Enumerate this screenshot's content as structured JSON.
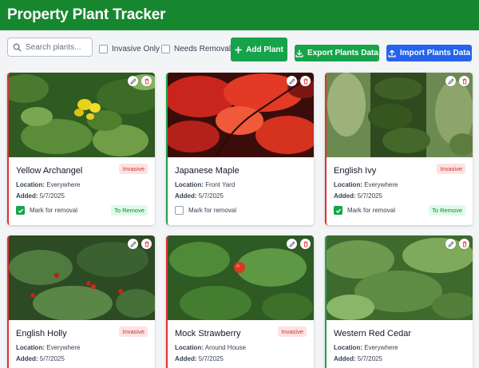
{
  "app": {
    "title": "Property Plant Tracker"
  },
  "toolbar": {
    "search_placeholder": "Search plants...",
    "filter_invasive_label": "Invasive Only",
    "filter_removal_label": "Needs Removal",
    "add_label": "Add Plant",
    "export_label": "Export Plants Data",
    "import_label": "Import Plants Data"
  },
  "labels": {
    "location": "Location:",
    "added": "Added:",
    "mark_removal": "Mark for removal",
    "invasive_badge": "Invasive",
    "remove_badge": "To Remove"
  },
  "plants": [
    {
      "name": "Yellow Archangel",
      "location": "Everywhere",
      "added": "5/7/2025",
      "invasive": true,
      "marked": true
    },
    {
      "name": "Japanese Maple",
      "location": "Front Yard",
      "added": "5/7/2025",
      "invasive": false,
      "marked": false
    },
    {
      "name": "English Ivy",
      "location": "Everywhere",
      "added": "5/7/2025",
      "invasive": true,
      "marked": true
    },
    {
      "name": "English Holly",
      "location": "Everywhere",
      "added": "5/7/2025",
      "invasive": true,
      "marked": false
    },
    {
      "name": "Mock Strawberry",
      "location": "Around House",
      "added": "5/7/2025",
      "invasive": true,
      "marked": false
    },
    {
      "name": "Western Red Cedar",
      "location": "Everywhere",
      "added": "5/7/2025",
      "invasive": false,
      "marked": false
    }
  ],
  "colors": {
    "header": "#17872f",
    "primary_green": "#16a34a",
    "primary_blue": "#2563eb",
    "invasive_border": "#e03131",
    "native_border": "#22a04a"
  }
}
